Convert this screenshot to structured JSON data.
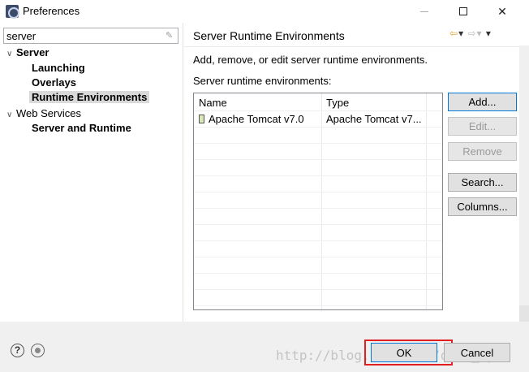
{
  "window": {
    "title": "Preferences",
    "icon": "eclipse-preferences-icon",
    "controls": [
      "minimize-icon",
      "maximize-icon",
      "close-icon"
    ]
  },
  "filter": {
    "value": "server"
  },
  "tree": [
    {
      "label": "Server",
      "expanded": true,
      "level": 0,
      "bold": true
    },
    {
      "label": "Launching",
      "level": 1,
      "bold": true
    },
    {
      "label": "Overlays",
      "level": 1,
      "bold": true
    },
    {
      "label": "Runtime Environments",
      "level": 1,
      "bold": true,
      "selected": true
    },
    {
      "label": "Web Services",
      "expanded": true,
      "level": 0,
      "bold": false
    },
    {
      "label": "Server and Runtime",
      "level": 1,
      "bold": true
    }
  ],
  "page": {
    "title": "Server Runtime Environments",
    "description": "Add, remove, or edit server runtime environments.",
    "list_label": "Server runtime environments:"
  },
  "table": {
    "columns": [
      "Name",
      "Type"
    ],
    "rows": [
      {
        "name": "Apache Tomcat v7.0",
        "type": "Apache Tomcat v7..."
      }
    ]
  },
  "buttons": {
    "add": "Add...",
    "edit": "Edit...",
    "remove": "Remove",
    "search": "Search...",
    "columns": "Columns..."
  },
  "footer": {
    "ok": "OK",
    "cancel": "Cancel",
    "watermark": "http://blog.csdn.net/csdn_ayue"
  },
  "colors": {
    "highlight": "#e02020",
    "default_button_border": "#0078d7",
    "selection": "#d9d9d9"
  }
}
